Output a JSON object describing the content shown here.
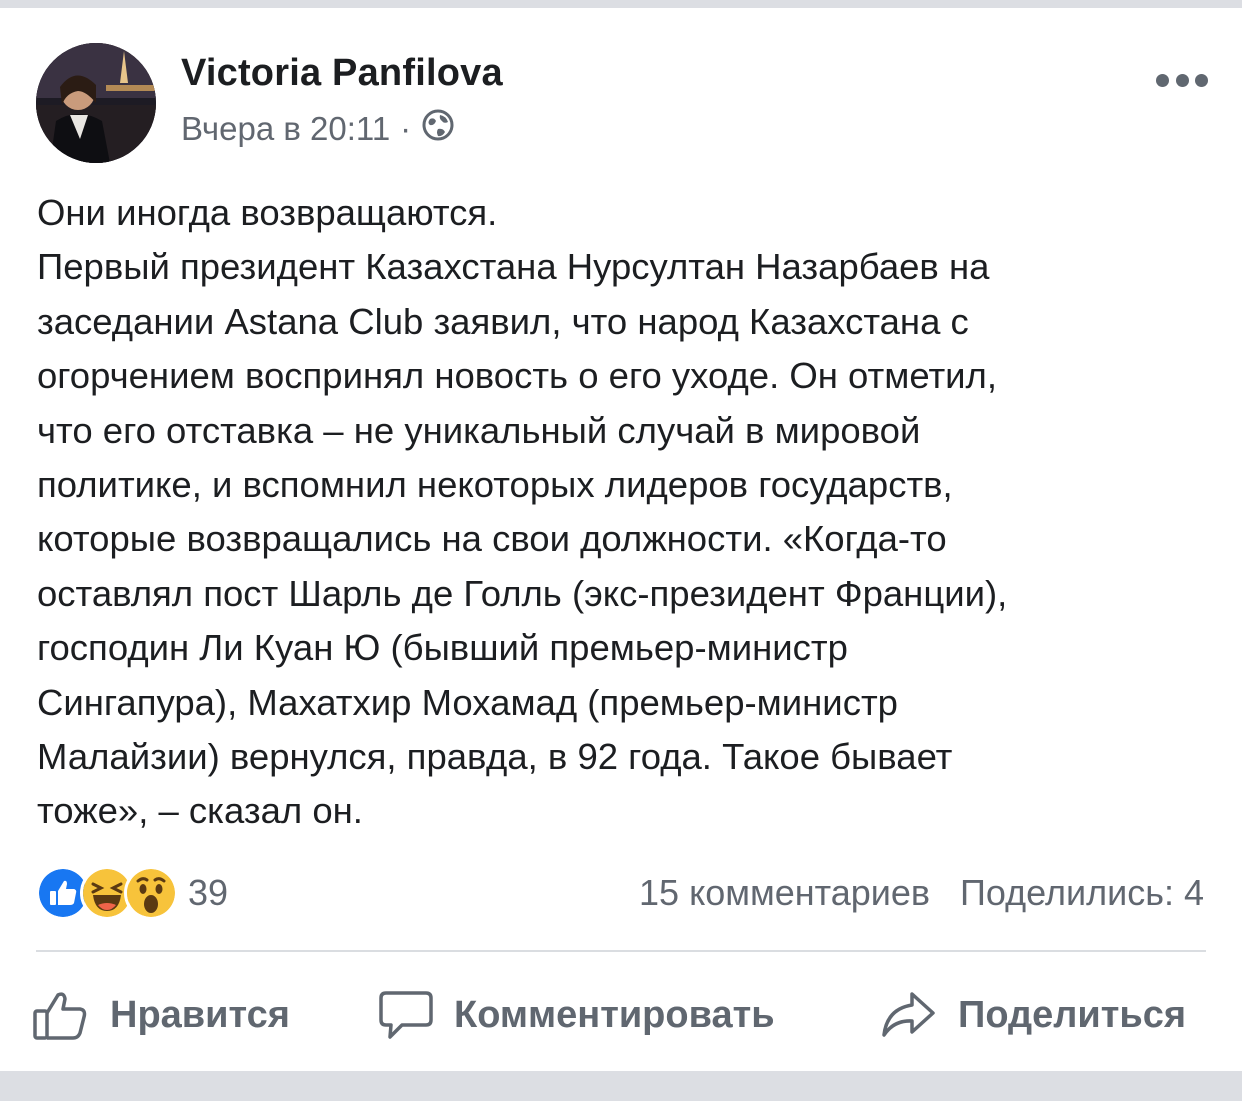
{
  "post": {
    "author": "Victoria Panfilova",
    "time": "Вчера в 20:11",
    "separator": "·",
    "privacy_icon": "globe-icon",
    "text": "Они иногда возвращаются.\nПервый президент Казахстана Нурсултан Назарбаев на\nзаседании Astana Club заявил, что народ Казахстана с\nогорчением воспринял новость о его уходе. Он отметил,\nчто его отставка – не уникальный случай в мировой\nполитике, и вспомнил некоторых лидеров государств,\nкоторые возвращались на свои должности. «Когда-то\nоставлял пост Шарль де Голль (экс-президент Франции),\nгосподин Ли Куан Ю (бывший премьер-министр\nСингапура), Махатхир Мохамад (премьер-министр\nМалайзии) вернулся, правда, в 92 года. Такое бывает\nтоже», – сказал он."
  },
  "reactions": {
    "types": [
      "like",
      "haha",
      "wow"
    ],
    "count": "39"
  },
  "stats": {
    "comments": "15 комментариев",
    "shares": "Поделились: 4"
  },
  "actions": {
    "like": "Нравится",
    "comment": "Комментировать",
    "share": "Поделиться"
  },
  "colors": {
    "like_blue": "#1877f2",
    "emoji_yellow": "#f7c33b",
    "text": "#1c1e21",
    "muted": "#616770"
  }
}
